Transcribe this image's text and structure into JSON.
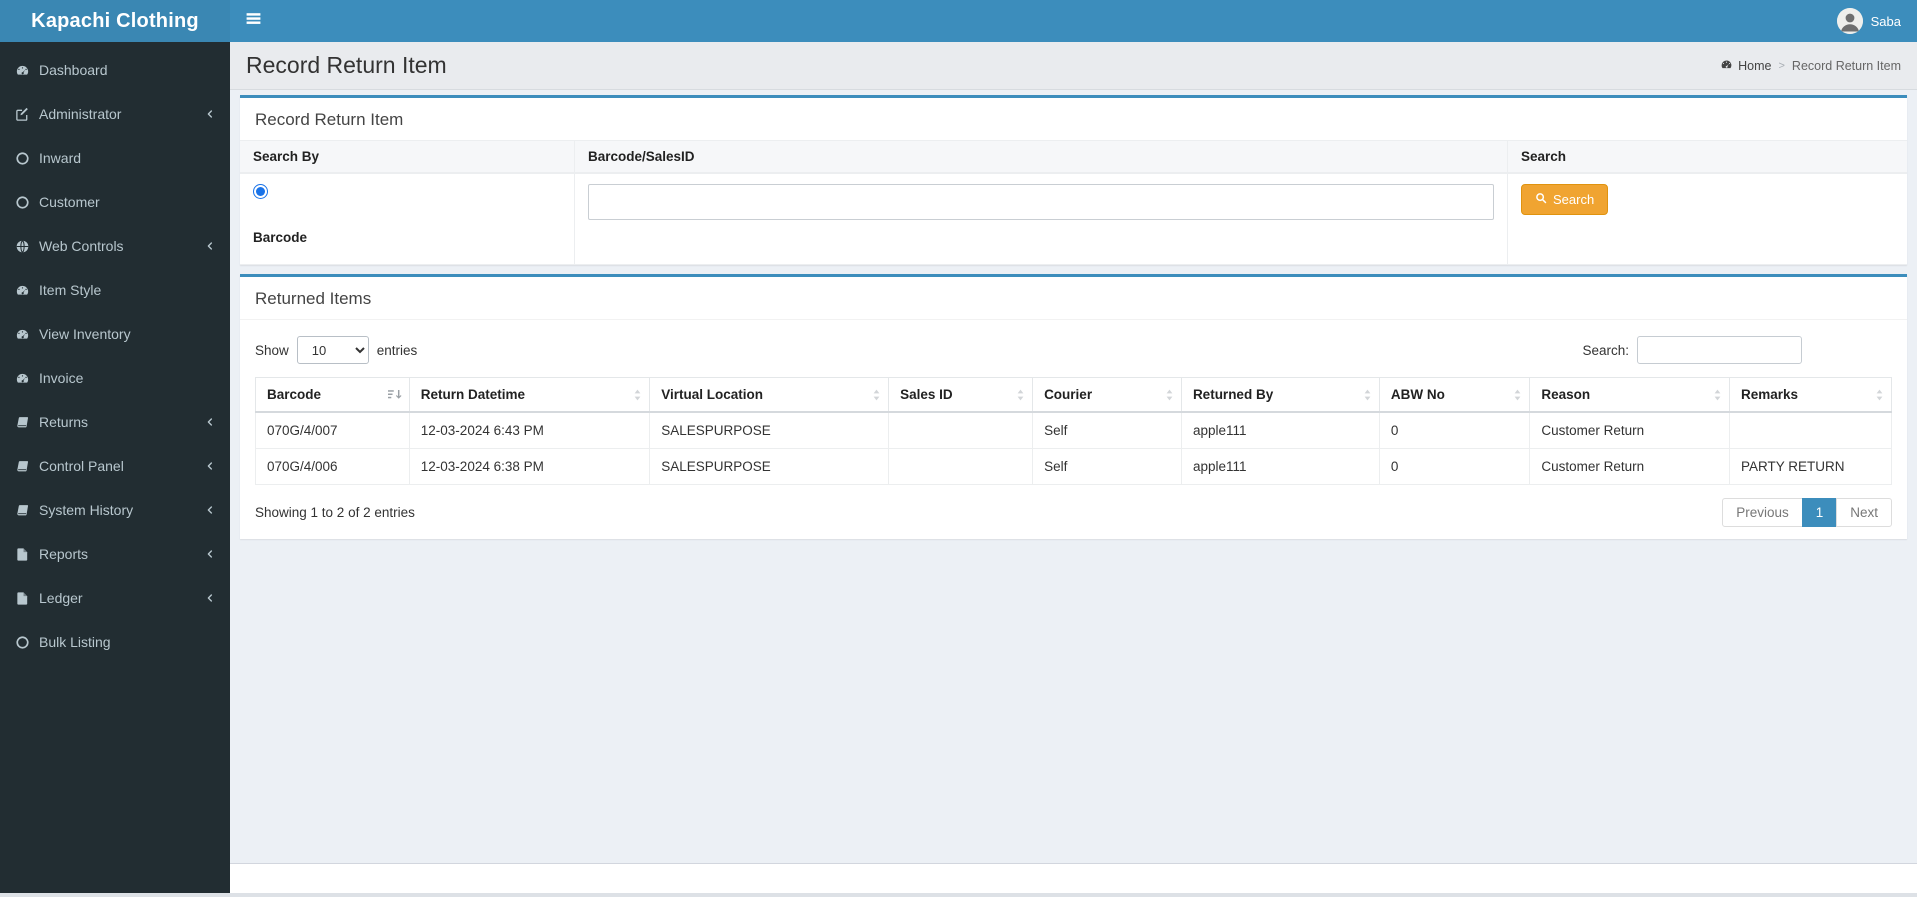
{
  "app": {
    "title": "Kapachi Clothing"
  },
  "navbar": {
    "user_name": "Saba"
  },
  "sidebar": {
    "items": [
      {
        "label": "Dashboard",
        "icon": "gauge",
        "chevron": false
      },
      {
        "label": "Administrator",
        "icon": "edit",
        "chevron": true
      },
      {
        "label": "Inward",
        "icon": "circle",
        "chevron": false
      },
      {
        "label": "Customer",
        "icon": "circle",
        "chevron": false
      },
      {
        "label": "Web Controls",
        "icon": "globe",
        "chevron": true
      },
      {
        "label": "Item Style",
        "icon": "gauge",
        "chevron": false
      },
      {
        "label": "View Inventory",
        "icon": "gauge",
        "chevron": false
      },
      {
        "label": "Invoice",
        "icon": "gauge",
        "chevron": false
      },
      {
        "label": "Returns",
        "icon": "book",
        "chevron": true
      },
      {
        "label": "Control Panel",
        "icon": "book",
        "chevron": true
      },
      {
        "label": "System History",
        "icon": "book",
        "chevron": true
      },
      {
        "label": "Reports",
        "icon": "file",
        "chevron": true
      },
      {
        "label": "Ledger",
        "icon": "file",
        "chevron": true
      },
      {
        "label": "Bulk Listing",
        "icon": "circle",
        "chevron": false
      }
    ]
  },
  "header": {
    "page_title": "Record Return Item",
    "breadcrumb": {
      "home": "Home",
      "current": "Record Return Item"
    }
  },
  "search_box": {
    "title": "Record Return Item",
    "col_search_by": "Search By",
    "col_barcode_salesid": "Barcode/SalesID",
    "col_search": "Search",
    "radio_label": "Barcode",
    "radio_selected": true,
    "input_value": "",
    "button_label": "Search"
  },
  "returned_items": {
    "title": "Returned Items",
    "show_label": "Show",
    "page_size": "10",
    "entries_label": "entries",
    "search_label": "Search:",
    "search_value": "",
    "columns": [
      "Barcode",
      "Return Datetime",
      "Virtual Location",
      "Sales ID",
      "Courier",
      "Returned By",
      "ABW No",
      "Reason",
      "Remarks"
    ],
    "rows": [
      [
        "070G/4/007",
        "12-03-2024 6:43 PM",
        "SALESPURPOSE",
        "",
        "Self",
        "apple111",
        "0",
        "Customer Return",
        ""
      ],
      [
        "070G/4/006",
        "12-03-2024 6:38 PM",
        "SALESPURPOSE",
        "",
        "Self",
        "apple111",
        "0",
        "Customer Return",
        "PARTY RETURN"
      ]
    ],
    "info": "Showing 1 to 2 of 2 entries",
    "pagination": {
      "previous": "Previous",
      "page": "1",
      "next": "Next"
    }
  },
  "colors": {
    "navbar": "#3c8dbc",
    "sidebar": "#222d32",
    "box_accent": "#3c8dbc",
    "search_button": "#f0a431",
    "active_page": "#3c8dbc",
    "page_background": "#ecf0f5"
  }
}
